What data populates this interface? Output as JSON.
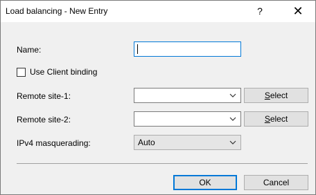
{
  "window": {
    "title": "Load balancing - New Entry",
    "help_label": "?",
    "close_label": "✕"
  },
  "form": {
    "name_label": "Name:",
    "name_value": "",
    "client_binding_label": "Use Client binding",
    "client_binding_checked": false,
    "remote1_label": "Remote site-1:",
    "remote1_value": "",
    "remote1_select_first": "S",
    "remote1_select_rest": "elect",
    "remote2_label": "Remote site-2:",
    "remote2_value": "",
    "remote2_select_first": "S",
    "remote2_select_rest": "elect",
    "masq_label": "IPv4 masquerading:",
    "masq_value": "Auto"
  },
  "buttons": {
    "ok_label": "OK",
    "cancel_label": "Cancel"
  }
}
